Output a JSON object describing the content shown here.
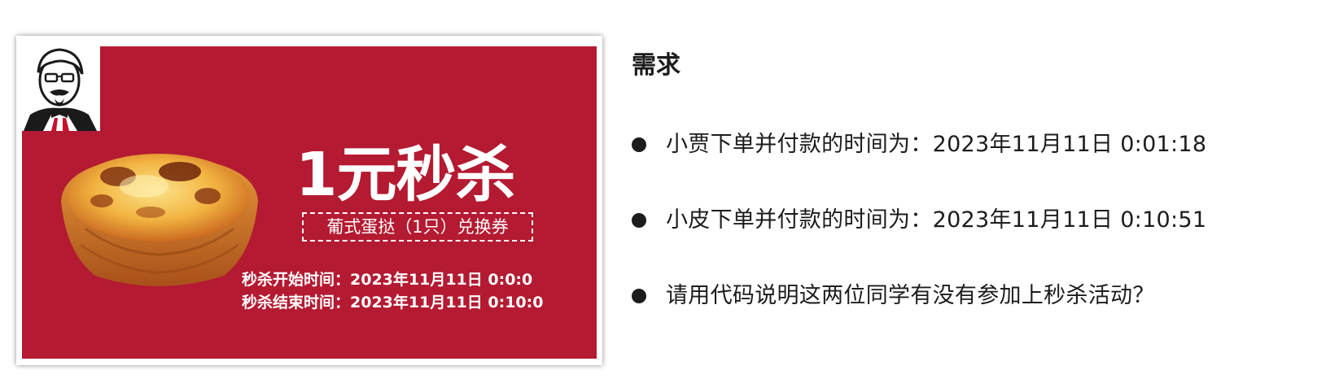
{
  "coupon": {
    "headline": "1元秒杀",
    "voucher_label": "葡式蛋挞（1只）兑换券",
    "start_time_line": "秒杀开始时间：2023年11月11日 0:0:0",
    "end_time_line": "秒杀结束时间：2023年11月11日 0:10:0",
    "background_color": "#b41a31",
    "mascot_icon": "colonel-mascot-icon",
    "product_image": "egg-tart-image"
  },
  "requirements": {
    "title": "需求",
    "items": [
      "小贾下单并付款的时间为：2023年11月11日 0:01:18",
      "小皮下单并付款的时间为：2023年11月11日 0:10:51",
      "请用代码说明这两位同学有没有参加上秒杀活动？"
    ]
  }
}
